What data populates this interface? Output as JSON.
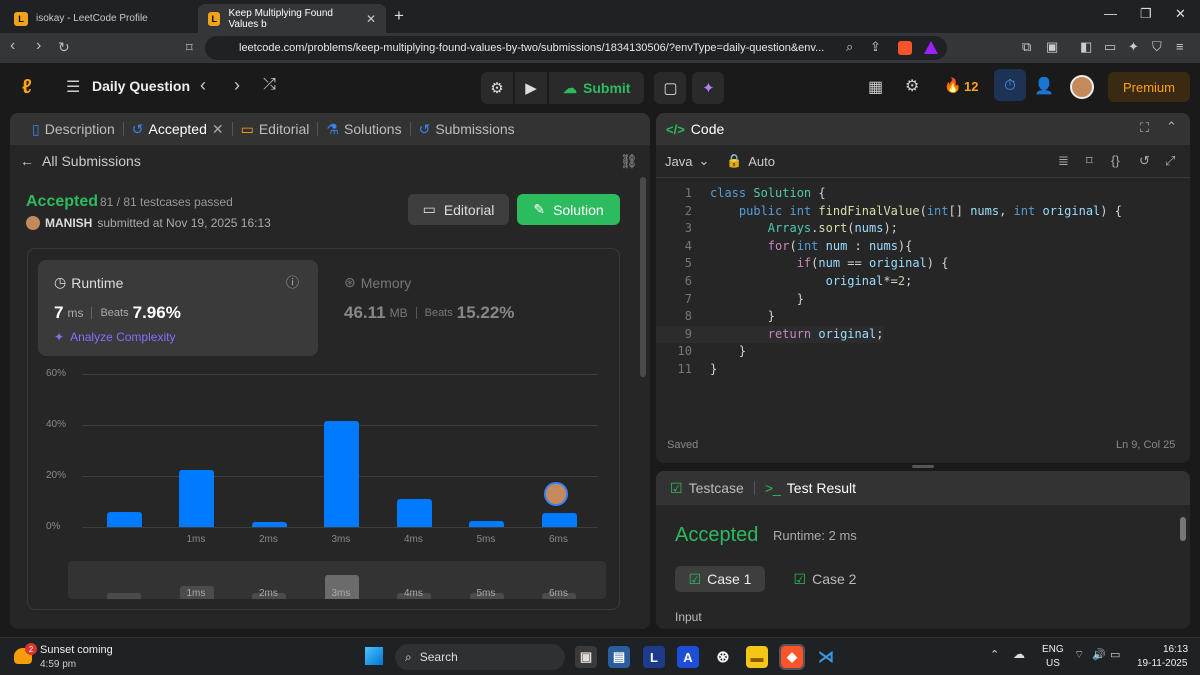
{
  "browser": {
    "tabs": [
      {
        "title": "isokay - LeetCode Profile"
      },
      {
        "title": "Keep Multiplying Found Values b"
      }
    ],
    "url": "leetcode.com/problems/keep-multiplying-found-values-by-two/submissions/1834130506/?envType=daily-question&env..."
  },
  "topbar": {
    "title": "Daily Question",
    "submit_label": "Submit",
    "streak": "12",
    "premium_label": "Premium"
  },
  "left_tabs": [
    {
      "label": "Description"
    },
    {
      "label": "Accepted"
    },
    {
      "label": "Editorial"
    },
    {
      "label": "Solutions"
    },
    {
      "label": "Submissions"
    }
  ],
  "submission": {
    "back_label": "All Submissions",
    "status": "Accepted",
    "testcases": "81 / 81 testcases passed",
    "user": "MANISH",
    "submitted_at": "submitted at Nov 19, 2025 16:13",
    "editorial_btn": "Editorial",
    "solution_btn": "Solution",
    "runtime_label": "Runtime",
    "runtime_value": "7",
    "runtime_unit": "ms",
    "beats_label": "Beats",
    "runtime_beats": "7.96%",
    "analyze_label": "Analyze Complexity",
    "memory_label": "Memory",
    "memory_value": "46.11",
    "memory_unit": "MB",
    "memory_beats": "15.22%"
  },
  "chart_data": {
    "type": "bar",
    "categories": [
      "",
      "1ms",
      "2ms",
      "3ms",
      "4ms",
      "5ms",
      "6ms"
    ],
    "values": [
      6,
      22.5,
      2,
      41.5,
      11,
      2.5,
      5.5
    ],
    "ylim": [
      0,
      60
    ],
    "yticks": [
      "0%",
      "20%",
      "40%",
      "60%"
    ],
    "grid": true,
    "colors": {
      "bar": "#007aff"
    }
  },
  "editor": {
    "title": "Code",
    "language": "Java",
    "mode": "Auto",
    "lines": [
      "class Solution {",
      "    public int findFinalValue(int[] nums, int original) {",
      "        Arrays.sort(nums);",
      "        for(int num : nums){",
      "            if(num == original) {",
      "                original*=2;",
      "            }",
      "        }",
      "        return original;",
      "    }",
      "}"
    ],
    "saved": "Saved",
    "cursor": "Ln 9, Col 25"
  },
  "testpanel": {
    "tab1": "Testcase",
    "tab2": "Test Result",
    "status": "Accepted",
    "runtime": "Runtime: 2 ms",
    "case1": "Case 1",
    "case2": "Case 2",
    "input_label": "Input"
  },
  "taskbar": {
    "weather_title": "Sunset coming",
    "weather_time": "4:59 pm",
    "search": "Search",
    "lang1": "ENG",
    "lang2": "US",
    "time": "16:13",
    "date": "19-11-2025",
    "notif": "2"
  }
}
